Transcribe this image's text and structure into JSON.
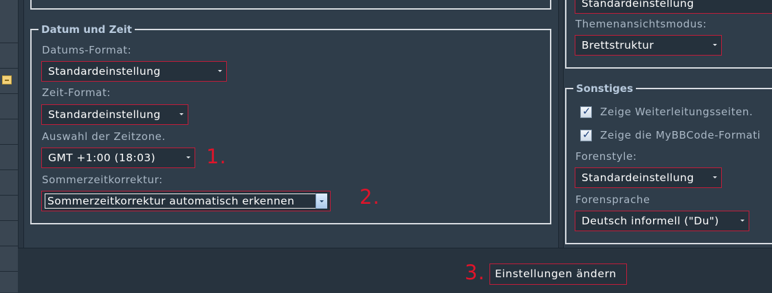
{
  "datum_zeit": {
    "legend": "Datum und Zeit",
    "datums_format": {
      "label": "Datums-Format:",
      "value": "Standardeinstellung"
    },
    "zeit_format": {
      "label": "Zeit-Format:",
      "value": "Standardeinstellung"
    },
    "zeitzone": {
      "label": "Auswahl der Zeitzone.",
      "value": "GMT +1:00 (18:03)"
    },
    "sommerzeit": {
      "label": "Sommerzeitkorrektur:",
      "value": "Sommerzeitkorrektur automatisch erkennen"
    }
  },
  "right": {
    "top_select_value": "Standardeinstellung",
    "themenansicht": {
      "label": "Themenansichtsmodus:",
      "value": "Brettstruktur"
    },
    "sonstiges": {
      "legend": "Sonstiges",
      "checkbox1": "Zeige Weiterleitungsseiten.",
      "checkbox2": "Zeige die MyBBCode-Formati",
      "forenstyle": {
        "label": "Forenstyle:",
        "value": "Standardeinstellung"
      },
      "forensprache": {
        "label": "Forensprache",
        "value": "Deutsch informell (\"Du\")"
      }
    }
  },
  "markers": {
    "m1": "1.",
    "m2": "2.",
    "m3": "3."
  },
  "submit_label": "Einstellungen ändern",
  "icons": {
    "rail_icon": "minus-box-icon",
    "dropdown": "chevron-down-icon",
    "check": "check-icon"
  },
  "colors": {
    "accent_border": "#c21d3a",
    "marker": "#e0142a",
    "label": "#aab8c6",
    "legend": "#b7c9dc"
  }
}
